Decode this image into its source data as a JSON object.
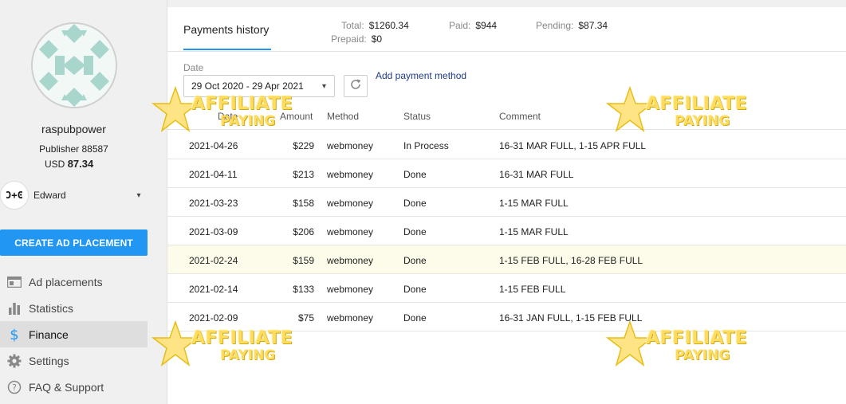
{
  "profile": {
    "username": "raspubpower",
    "publisher": "Publisher 88587",
    "currency": "USD",
    "balance": "87.34"
  },
  "account": {
    "logo_text": "Ͻ+Ͼ",
    "name": "Edward"
  },
  "actions": {
    "create_label": "CREATE AD PLACEMENT"
  },
  "nav": [
    {
      "label": "Ad placements",
      "icon": "ad-placements-icon"
    },
    {
      "label": "Statistics",
      "icon": "bar-chart-icon"
    },
    {
      "label": "Finance",
      "icon": "dollar-icon",
      "active": true
    },
    {
      "label": "Settings",
      "icon": "gear-icon"
    },
    {
      "label": "FAQ & Support",
      "icon": "help-icon"
    }
  ],
  "main": {
    "tab_label": "Payments history",
    "summary": {
      "total_label": "Total:",
      "total_value": "$1260.34",
      "prepaid_label": "Prepaid:",
      "prepaid_value": "$0",
      "paid_label": "Paid:",
      "paid_value": "$944",
      "pending_label": "Pending:",
      "pending_value": "$87.34"
    },
    "date_label": "Date",
    "date_range": "29 Oct 2020 - 29 Apr 2021",
    "add_payment_label": "Add payment method"
  },
  "table": {
    "headers": {
      "date": "Date",
      "amount": "Amount",
      "method": "Method",
      "status": "Status",
      "comment": "Comment"
    },
    "rows": [
      {
        "date": "2021-04-26",
        "amount": "$229",
        "method": "webmoney",
        "status": "In Process",
        "comment": "16-31 MAR FULL, 1-15 APR FULL"
      },
      {
        "date": "2021-04-11",
        "amount": "$213",
        "method": "webmoney",
        "status": "Done",
        "comment": "16-31 MAR FULL"
      },
      {
        "date": "2021-03-23",
        "amount": "$158",
        "method": "webmoney",
        "status": "Done",
        "comment": "1-15 MAR FULL"
      },
      {
        "date": "2021-03-09",
        "amount": "$206",
        "method": "webmoney",
        "status": "Done",
        "comment": "1-15 MAR FULL"
      },
      {
        "date": "2021-02-24",
        "amount": "$159",
        "method": "webmoney",
        "status": "Done",
        "comment": "1-15 FEB FULL, 16-28 FEB FULL"
      },
      {
        "date": "2021-02-14",
        "amount": "$133",
        "method": "webmoney",
        "status": "Done",
        "comment": "1-15 FEB FULL"
      },
      {
        "date": "2021-02-09",
        "amount": "$75",
        "method": "webmoney",
        "status": "Done",
        "comment": "16-31 JAN FULL, 1-15 FEB FULL"
      }
    ]
  },
  "watermark": {
    "line1": "AFFILIATE",
    "line2": "PAYING"
  },
  "colors": {
    "accent": "#2196f3",
    "link": "#1f3a8a",
    "row_highlight": "#fdfcea"
  }
}
